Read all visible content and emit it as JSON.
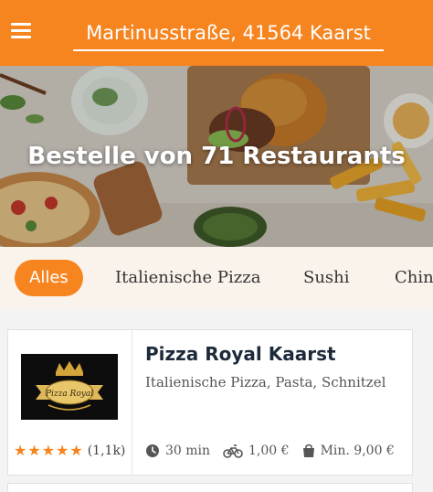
{
  "header": {
    "address": "Martinusstraße, 41564 Kaarst",
    "menu_icon": "hamburger-menu-icon",
    "background_color": "#f6841f"
  },
  "hero": {
    "title": "Bestelle von 71 Restaurants"
  },
  "categories": [
    {
      "label": "Alles",
      "active": true
    },
    {
      "label": "Italienische Pizza",
      "active": false
    },
    {
      "label": "Sushi",
      "active": false
    },
    {
      "label": "Chin",
      "active": false
    }
  ],
  "restaurant": {
    "name": "Pizza Royal Kaarst",
    "cuisine": "Italienische Pizza, Pasta, Schnitzel",
    "logo_text": "Pizza Royal",
    "rating_stars": 5,
    "rating_count": "(1,1k)",
    "delivery_time": "30 min",
    "delivery_fee": "1,00 €",
    "min_order": "Min. 9,00 €",
    "icons": {
      "time": "clock-icon",
      "fee": "bicycle-icon",
      "min": "shopping-bag-icon"
    }
  },
  "colors": {
    "accent": "#f6841f",
    "name_text": "#1e2a3a"
  }
}
